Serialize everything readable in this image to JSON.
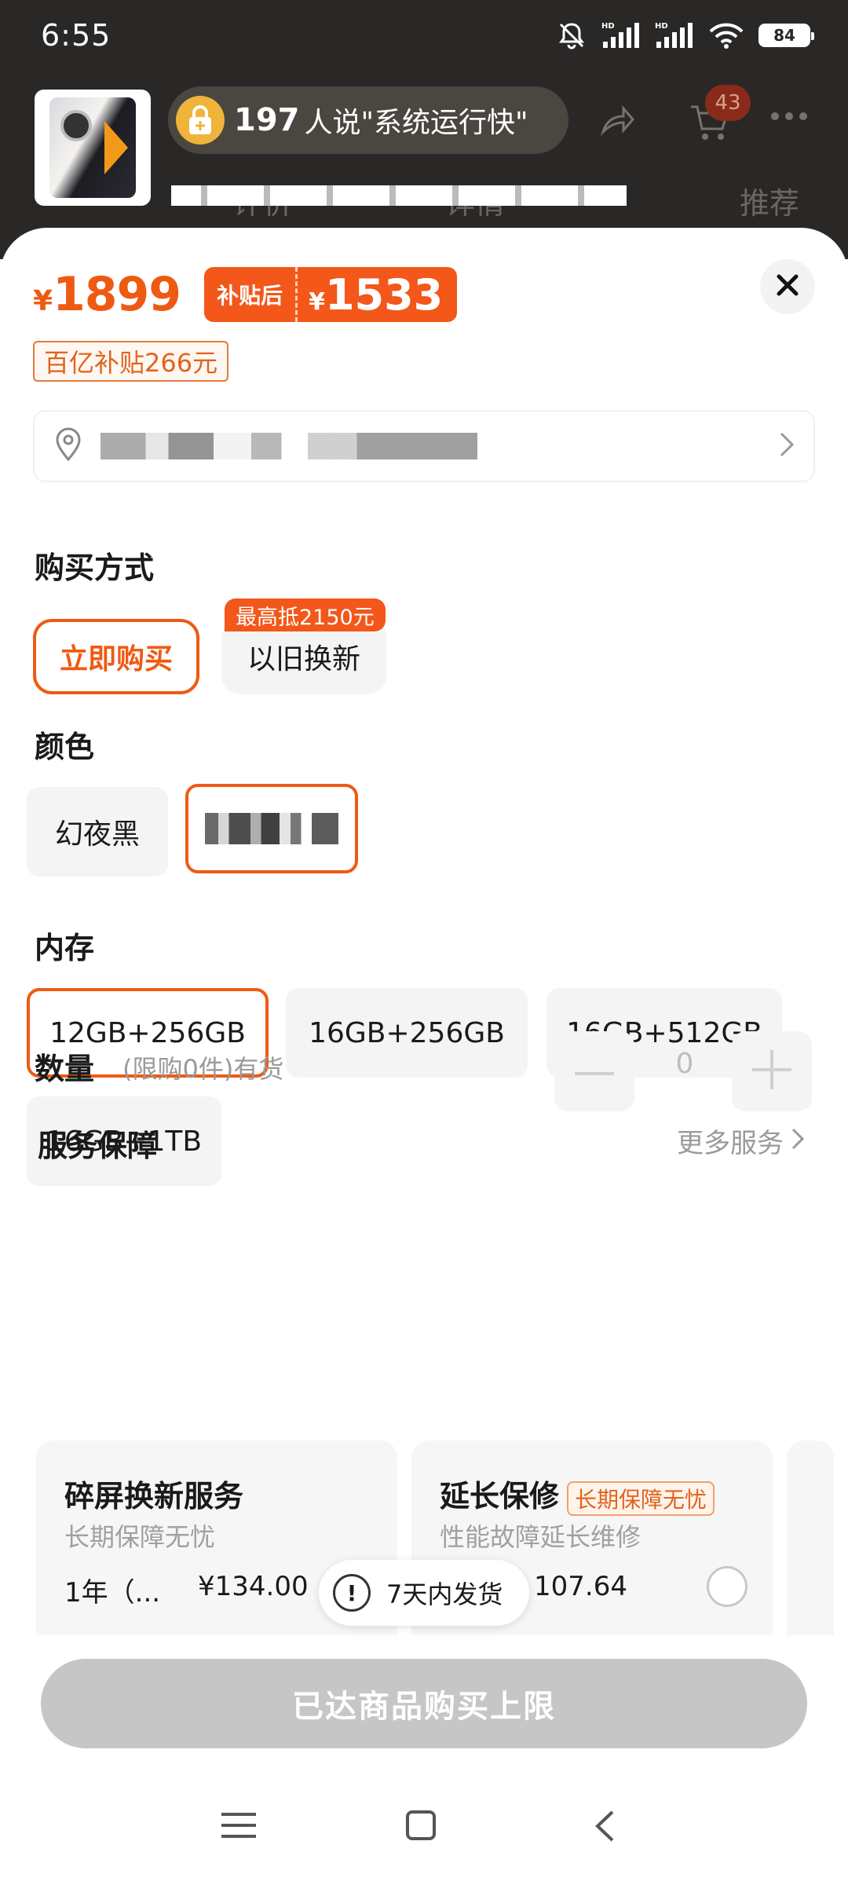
{
  "status_bar": {
    "time": "6:55",
    "battery": "84",
    "icons": [
      "bell-off-icon",
      "signal-icon",
      "signal-icon",
      "wifi-icon",
      "battery-icon"
    ]
  },
  "background_header": {
    "social_count": "197",
    "social_text": "人说\"系统运行快\"",
    "cart_badge": "43",
    "tab_recommend": "推荐",
    "tab_reviews": "评价",
    "tab_details": "详情"
  },
  "price": {
    "currency": "¥",
    "original": "1899",
    "subsidy_label": "补贴后",
    "subsidized": "1533",
    "subsidy_badge": "百亿补贴266元"
  },
  "sections": {
    "purchase_method": "购买方式",
    "color": "颜色",
    "memory": "内存",
    "quantity": "数量",
    "service": "服务保障"
  },
  "purchase_options": [
    {
      "label": "立即购买",
      "selected": true
    },
    {
      "label": "以旧换新",
      "ribbon": "最高抵2150元",
      "selected": false
    }
  ],
  "colors": [
    {
      "label": "幻夜黑",
      "selected": false
    },
    {
      "label": "",
      "selected": true
    }
  ],
  "memory_options": [
    {
      "label": "12GB+256GB",
      "selected": true
    },
    {
      "label": "16GB+256GB",
      "selected": false
    },
    {
      "label": "16GB+512GB",
      "selected": false
    },
    {
      "label": "16GB+1TB",
      "selected": false
    }
  ],
  "quantity": {
    "note": "(限购0件)有货",
    "value": "0"
  },
  "services": {
    "more_label": "更多服务",
    "cards": [
      {
        "title": "碎屏换新服务",
        "subtitle": "长期保障无忧",
        "plan": "1年（...",
        "price": "¥134.00"
      },
      {
        "title": "延长保修",
        "tag": "长期保障无忧",
        "subtitle": "性能故障延长维修",
        "plan": "",
        "price": "107.64"
      }
    ]
  },
  "toast": {
    "text": "7天内发货"
  },
  "cta": {
    "label": "已达商品购买上限"
  },
  "colors_theme": {
    "accent": "#EF5A12",
    "accent_tag": "#F3571A",
    "disabled_button": "#C6C6C6"
  }
}
